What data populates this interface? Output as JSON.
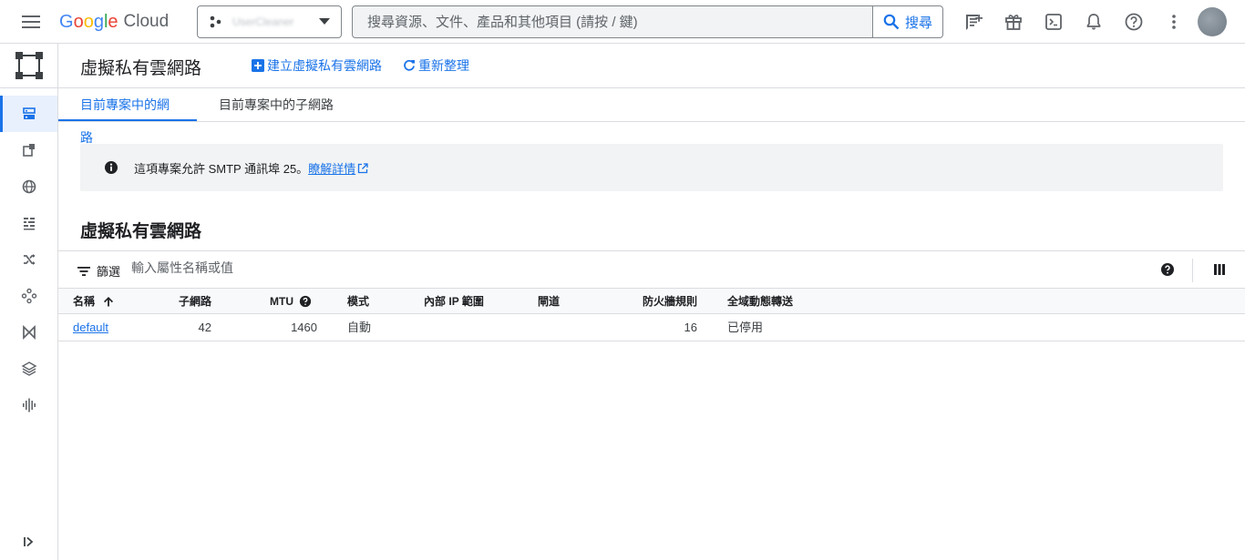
{
  "topbar": {
    "logo_google": "Google",
    "logo_cloud": "Cloud",
    "project_name": "UserCleaner",
    "search_placeholder": "搜尋資源、文件、產品和其他項目 (請按 / 鍵)",
    "search_button": "搜尋",
    "icons": [
      "notes-icon",
      "gift-icon",
      "cloud-shell-icon",
      "bell-icon",
      "help-icon",
      "more-vert-icon"
    ]
  },
  "leftnav": {
    "items": [
      "vpc-networks-icon",
      "ip-addresses-icon",
      "internal-ranges-icon",
      "firewall-icon",
      "routes-icon",
      "peering-icon",
      "shared-vpc-icon",
      "serverless-connector-icon",
      "packet-mirroring-icon"
    ]
  },
  "header": {
    "title": "虛擬私有雲網路",
    "create_label": "建立虛擬私有雲網路",
    "refresh_label": "重新整理"
  },
  "tabs": [
    {
      "label": "目前專案中的網路",
      "active": true
    },
    {
      "label": "目前專案中的子網路",
      "active": false
    }
  ],
  "banner": {
    "text": "這項專案允許 SMTP 通訊埠 25。",
    "link": "瞭解詳情"
  },
  "section_title": "虛擬私有雲網路",
  "filter": {
    "label": "篩選",
    "placeholder": "輸入屬性名稱或值"
  },
  "table": {
    "headers": {
      "name": "名稱",
      "subnets": "子網路",
      "mtu": "MTU",
      "mode": "模式",
      "internal_ip": "內部",
      "ip": "IP",
      "range": "範圍",
      "gateway": "閘道",
      "firewall_rules": "防火牆規則",
      "global_routing": "全域動態轉送"
    },
    "rows": [
      {
        "name": "default",
        "subnets": "42",
        "mtu": "1460",
        "mode": "自動",
        "internal_ip": "",
        "gateway": "",
        "firewall_rules": "16",
        "global_routing": "已停用"
      }
    ]
  },
  "colors": {
    "accent": "#1a73e8",
    "banner_bg": "#f1f3f4",
    "active_nav_bg": "#e8f0fe"
  }
}
